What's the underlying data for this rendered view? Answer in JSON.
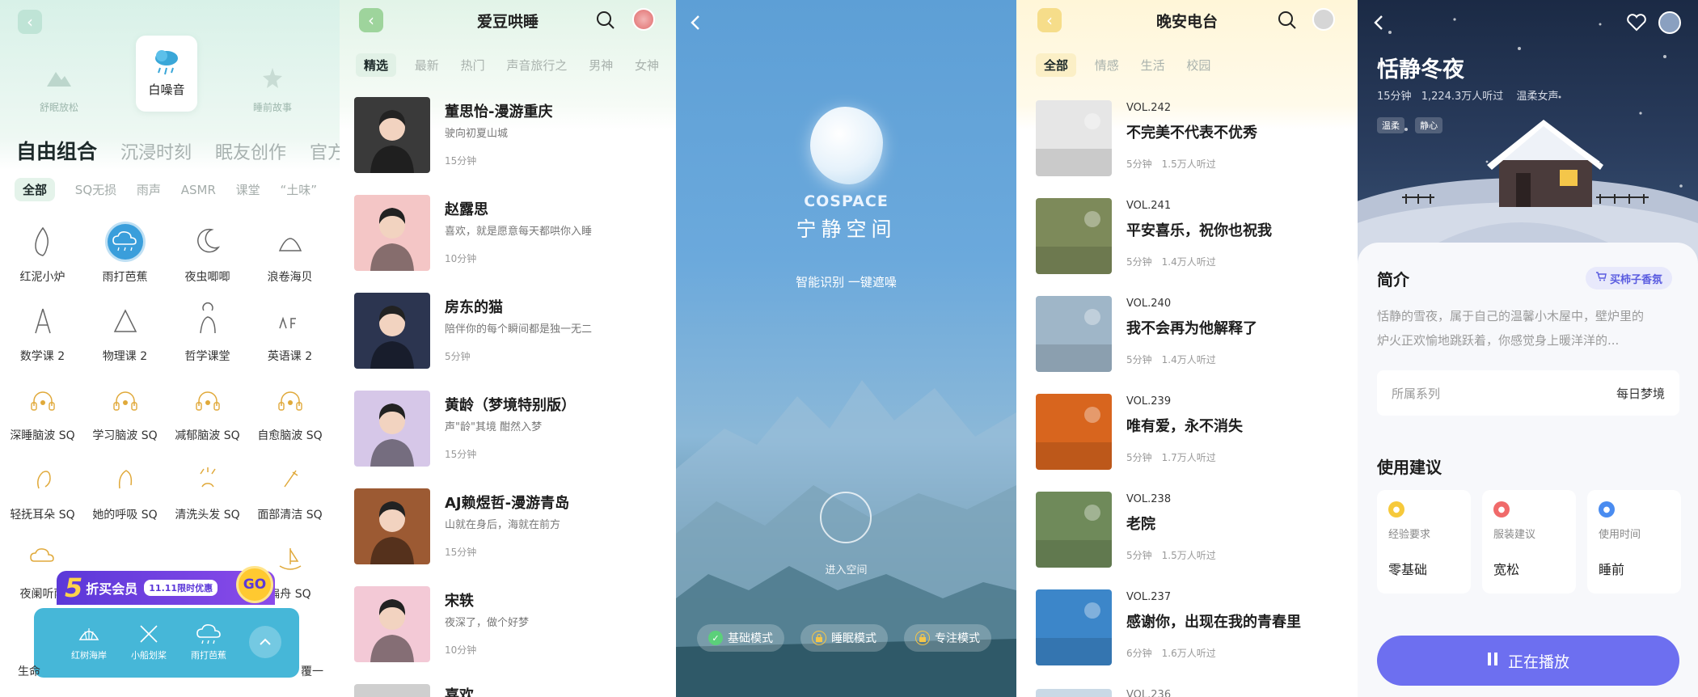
{
  "p1": {
    "top_modes": [
      {
        "label": "舒眠放松"
      },
      {
        "label": "白噪音"
      },
      {
        "label": "睡前故事"
      }
    ],
    "categories": [
      "自由组合",
      "沉浸时刻",
      "眠友创作",
      "官方推"
    ],
    "chips": [
      "全部",
      "SQ无损",
      "雨声",
      "ASMR",
      "课堂",
      "“土味”"
    ],
    "grid": [
      "红泥小炉",
      "雨打芭蕉",
      "夜虫唧唧",
      "浪卷海贝",
      "数学课 2",
      "物理课 2",
      "哲学课堂",
      "英语课 2",
      "深睡脑波 SQ",
      "学习脑波 SQ",
      "减郁脑波 SQ",
      "自愈脑波 SQ",
      "轻抚耳朵 SQ",
      "她的呼吸 SQ",
      "清洗头发 SQ",
      "面部清洁 SQ",
      "夜阑听雨",
      "",
      "",
      "扁舟 SQ"
    ],
    "promo": {
      "num": "5",
      "text": "折买会员",
      "tag": "11.11限时优惠",
      "go": "GO"
    },
    "mini_player": [
      "红树海岸",
      "小船划桨",
      "雨打芭蕉"
    ],
    "tail_left": "生命",
    "tail_right": "覆一"
  },
  "p2": {
    "title": "爱豆哄睡",
    "tabs": [
      "精选",
      "最新",
      "热门",
      "声音旅行之",
      "男神",
      "女神"
    ],
    "rows": [
      {
        "name": "董思怡-漫游重庆",
        "desc": "驶向初夏山城",
        "dur": "15分钟",
        "color": "#3a3a3a"
      },
      {
        "name": "赵露思",
        "desc": "喜欢，就是愿意每天都哄你入睡",
        "dur": "10分钟",
        "color": "#f4c6c6"
      },
      {
        "name": "房东的猫",
        "desc": "陪伴你的每个瞬间都是独一无二",
        "dur": "5分钟",
        "color": "#2c3550"
      },
      {
        "name": "黄龄（梦境特别版）",
        "desc": "声\"龄\"其境 酣然入梦",
        "dur": "15分钟",
        "color": "#d6c7e8"
      },
      {
        "name": "AJ赖煜哲-漫游青岛",
        "desc": "山就在身后，海就在前方",
        "dur": "15分钟",
        "color": "#9c5a33"
      },
      {
        "name": "宋轶",
        "desc": "夜深了，做个好梦",
        "dur": "10分钟",
        "color": "#f3c9d6"
      }
    ],
    "peek": "喜欢"
  },
  "p3": {
    "brand_en": "COSPACE",
    "brand_cn": "宁静空间",
    "slogan": "智能识别 一键遮噪",
    "enter": "进入空间",
    "modes": [
      "基础模式",
      "睡眠模式",
      "专注模式"
    ]
  },
  "p4": {
    "title": "晚安电台",
    "tabs": [
      "全部",
      "情感",
      "生活",
      "校园"
    ],
    "episodes": [
      {
        "vol": "VOL.242",
        "title": "不完美不代表不优秀",
        "dur": "5分钟",
        "plays": "1.5万人听过",
        "color": "#e6e6e6"
      },
      {
        "vol": "VOL.241",
        "title": "平安喜乐，祝你也祝我",
        "dur": "5分钟",
        "plays": "1.4万人听过",
        "color": "#7d8a5a"
      },
      {
        "vol": "VOL.240",
        "title": "我不会再为他解释了",
        "dur": "5分钟",
        "plays": "1.4万人听过",
        "color": "#9fb6c8"
      },
      {
        "vol": "VOL.239",
        "title": "唯有爱，永不消失",
        "dur": "5分钟",
        "plays": "1.7万人听过",
        "color": "#d8651e"
      },
      {
        "vol": "VOL.238",
        "title": "老院",
        "dur": "5分钟",
        "plays": "1.5万人听过",
        "color": "#6f8a5a"
      },
      {
        "vol": "VOL.237",
        "title": "感谢你，出现在我的青春里",
        "dur": "6分钟",
        "plays": "1.6万人听过",
        "color": "#3c86c9"
      }
    ],
    "peek": "VOL.236"
  },
  "p5": {
    "title": "恬静冬夜",
    "meta": [
      "15分钟",
      "1,224.3万人听过",
      "温柔女声"
    ],
    "tags": [
      "温柔",
      "静心"
    ],
    "intro_heading": "简介",
    "buy_btn": "买柿子香氛",
    "intro_text_1": "恬静的雪夜，属于自己的温馨小木屋中，壁炉里的",
    "intro_text_2": "炉火正欢愉地跳跃着，你感觉身上暖洋洋的...",
    "series_label": "所属系列",
    "series_value": "每日梦境",
    "advice_heading": "使用建议",
    "cards": [
      {
        "k": "经验要求",
        "v": "零基础",
        "color": "#f6c93b"
      },
      {
        "k": "服装建议",
        "v": "宽松",
        "color": "#f06a6a"
      },
      {
        "k": "使用时间",
        "v": "睡前",
        "color": "#4a8cf0"
      }
    ],
    "play": "正在播放"
  }
}
